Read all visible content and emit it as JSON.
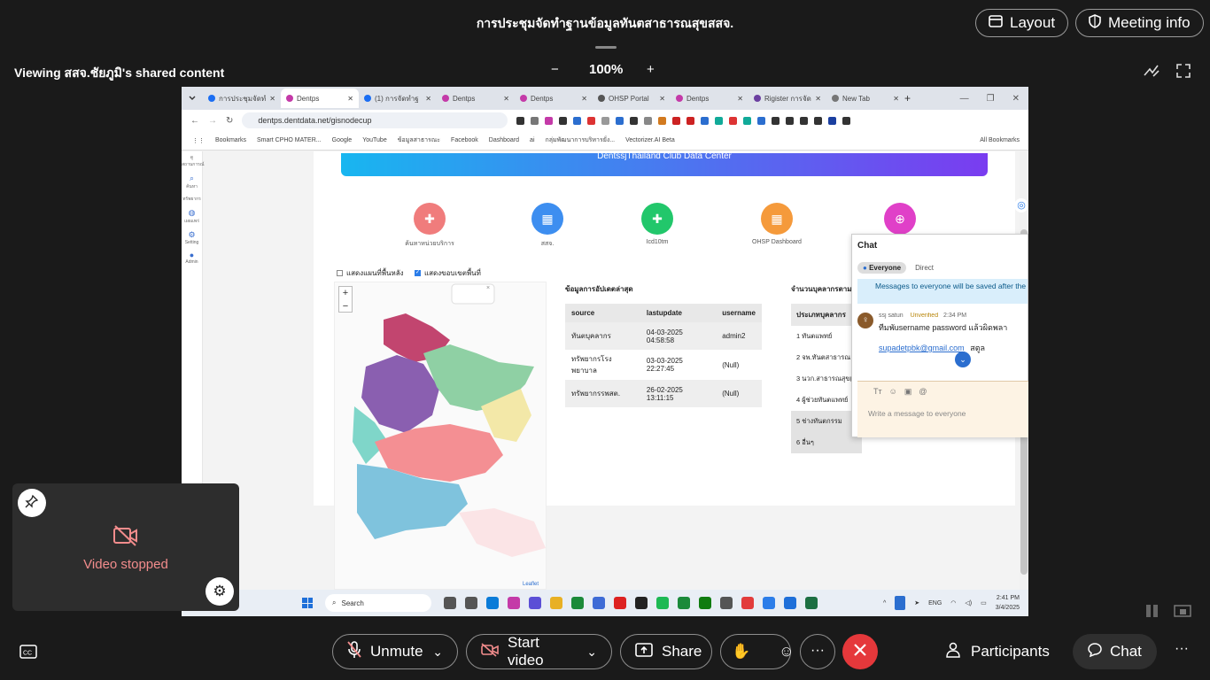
{
  "meeting": {
    "title": "การประชุมจัดทำฐานข้อมูลทันตสาธารณสุขสสจ.",
    "layout_label": "Layout",
    "meeting_info_label": "Meeting info",
    "viewing_text": "Viewing สสจ.ชัยภูมิ's shared content",
    "zoom": "100%",
    "zoom_out": "−",
    "zoom_in": "+"
  },
  "browser": {
    "tabs": [
      {
        "label": "การประชุมจัดทำ",
        "color": "#1b6ef3"
      },
      {
        "label": "Dentps",
        "color": "#c43aa8"
      },
      {
        "label": "(1) การจัดทำฐ",
        "color": "#1b6ef3"
      },
      {
        "label": "Dentps",
        "color": "#c43aa8"
      },
      {
        "label": "Dentps",
        "color": "#c43aa8"
      },
      {
        "label": "OHSP Portal",
        "color": "#555555"
      },
      {
        "label": "Dentps",
        "color": "#c43aa8"
      },
      {
        "label": "Rigister การจัด",
        "color": "#6b3fa0"
      },
      {
        "label": "New Tab",
        "color": "#777777"
      }
    ],
    "url": "dentps.dentdata.net/gisnodecup",
    "bookmarks": [
      "Bookmarks",
      "Smart CPHO MATER...",
      "Google",
      "YouTube",
      "ข้อมูลสาธารณะ",
      "Facebook",
      "Dashboard",
      "ai",
      "กลุ่มพัฒนาการบริหารยั่ง...",
      "Vectorizer.AI Beta"
    ],
    "all_bookmarks": "All Bookmarks"
  },
  "page": {
    "sidebar": [
      "ดูสถานการณ์",
      "ค้นหา",
      "ทรัพยากร",
      "เผยแพร่",
      "Setting",
      "Admin"
    ],
    "banner": "DentssjThailand Club Data Center",
    "menu": [
      {
        "label": "ค้นหาหน่วยบริการ",
        "color": "#f07c7c",
        "glyph": "✚"
      },
      {
        "label": "สสจ.",
        "color": "#3d8ef0",
        "glyph": "▦"
      },
      {
        "label": "Icd10tm",
        "color": "#22c76b",
        "glyph": "✚"
      },
      {
        "label": "OHSP Dashboard",
        "color": "#f59a3b",
        "glyph": "▦"
      },
      {
        "label": "",
        "color": "#e040c8",
        "glyph": "⊕"
      }
    ],
    "check_bg": "แสดงแผนที่พื้นหลัง",
    "check_border": "แสดงขอบเขตพื้นที่",
    "update_title": "ข้อมูลการอัปเดตล่าสุด",
    "update_headers": [
      "source",
      "lastupdate",
      "username"
    ],
    "update_rows": [
      [
        "ทันตบุคลากร",
        "04-03-2025 04:58:58",
        "admin2"
      ],
      [
        "ทรัพยากรโรงพยาบาล",
        "03-03-2025 22:27:45",
        "(Null)"
      ],
      [
        "ทรัพยากรรพสต.",
        "26-02-2025 13:11:15",
        "(Null)"
      ]
    ],
    "staff_title": "จำนวนบุคลากรตาม",
    "staff_header": "ประเภทบุคลากร",
    "staff_rows": [
      "1 ทันตแพทย์",
      "2 จพ.ทันตสาธารณ",
      "3 นวก.สาธารณสุข(",
      "4 ผู้ช่วยทันตแพทย์",
      "5 ช่างทันตกรรม",
      "6 อื่นๆ"
    ],
    "map_attr": "Leaflet",
    "map_zoom_in": "+",
    "map_zoom_out": "−",
    "map_popup_close": "×"
  },
  "chat_panel": {
    "title": "Chat",
    "tab_everyone": "Everyone",
    "tab_direct": "Direct",
    "notice": "Messages to everyone will be saved after the meeting.",
    "sender": "ssj satun",
    "sender_status": "Unverified",
    "time": "2:34 PM",
    "message": "ทีมพัusername password แล้วผิดพลา",
    "link": "supadetpbk@gmail.com",
    "message_tail": "สตูล",
    "placeholder": "Write a message to everyone"
  },
  "taskbar": {
    "search": "Search",
    "lang": "ENG",
    "time": "2:41 PM",
    "date": "3/4/2025"
  },
  "self_view": {
    "status": "Video stopped"
  },
  "controls": {
    "unmute": "Unmute",
    "start_video": "Start video",
    "share": "Share",
    "participants": "Participants",
    "chat": "Chat",
    "more": "···"
  },
  "colors": {
    "end_call": "#e5383b",
    "video_stopped": "#f28c8c"
  }
}
